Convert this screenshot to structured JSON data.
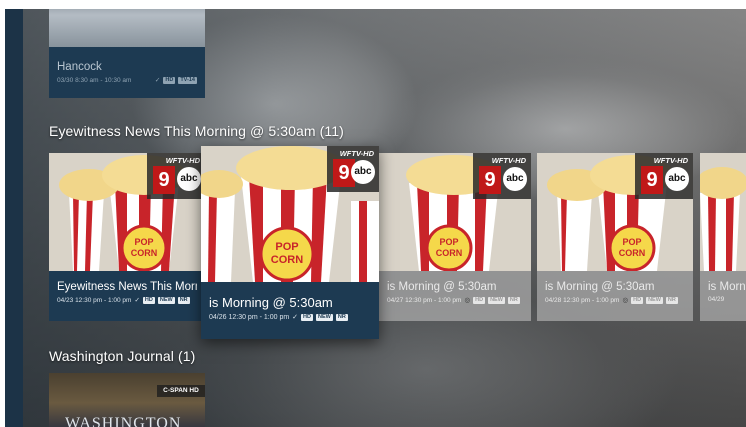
{
  "rows": [
    {
      "title": "",
      "cards": [
        {
          "title": "Hancock",
          "meta": "03/30 8:30 am - 10:30 am",
          "badges": [
            "HD",
            "TV-14"
          ]
        }
      ]
    },
    {
      "title": "Eyewitness News This Morning @ 5:30am (11)",
      "network": {
        "call": "WFTV-HD",
        "channel": "9",
        "logo": "abc"
      },
      "cards": [
        {
          "title": "Eyewitness News This Morn",
          "meta": "04/23 12:30 pm - 1:00 pm",
          "badges": [
            "HD",
            "NEW",
            "NR"
          ]
        },
        {
          "title": "is Morning @ 5:30am",
          "meta": "04/26 12:30 pm - 1:00 pm",
          "badges": [
            "HD",
            "NEW",
            "NR"
          ]
        },
        {
          "title": "is Morning @ 5:30am",
          "meta": "04/27 12:30 pm - 1:00 pm",
          "badges": [
            "HD",
            "NEW",
            "NR"
          ]
        },
        {
          "title": "is Morning @ 5:30am",
          "meta": "04/28 12:30 pm - 1:00 pm",
          "badges": [
            "HD",
            "NEW",
            "NR"
          ]
        },
        {
          "title": "is Morn",
          "meta": "04/29",
          "badges": []
        }
      ]
    },
    {
      "title": "Washington Journal (1)",
      "cards": [
        {
          "title": "",
          "meta": "",
          "badges": [],
          "network": "C-SPAN HD",
          "art_text": "WASHINGTON"
        }
      ]
    }
  ]
}
